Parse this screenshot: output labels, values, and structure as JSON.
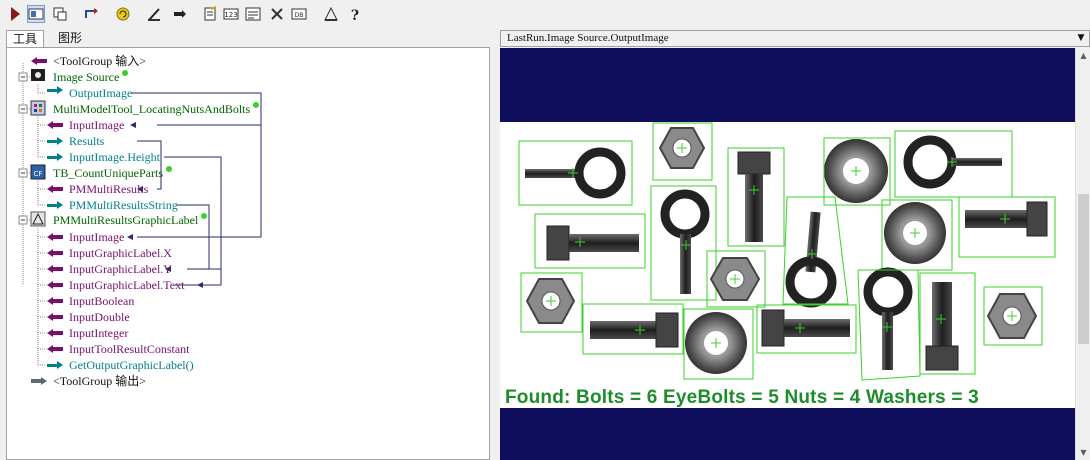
{
  "tabs": {
    "tools": "工具",
    "graphics": "图形"
  },
  "tree": {
    "group_input": "<ToolGroup 输入>",
    "image_source": "Image Source",
    "output_image": "OutputImage",
    "multi_model": "MultiModelTool_LocatingNutsAndBolts",
    "mm_input_image": "InputImage",
    "mm_results": "Results",
    "mm_input_height": "InputImage.Height",
    "tb_count": "TB_CountUniqueParts",
    "tb_pm_results": "PMMultiResults",
    "tb_pm_results_string": "PMMultiResultsString",
    "graphic_label": "PMMultiResultsGraphicLabel",
    "gl_input_image": "InputImage",
    "gl_x": "InputGraphicLabel.X",
    "gl_y": "InputGraphicLabel.Y",
    "gl_text": "InputGraphicLabel.Text",
    "gl_boolean": "InputBoolean",
    "gl_double": "InputDouble",
    "gl_integer": "InputInteger",
    "gl_result_constant": "InputToolResultConstant",
    "gl_get_output": "GetOutputGraphicLabel()",
    "group_output": "<ToolGroup 输出>"
  },
  "viewer": {
    "title": "LastRun.Image Source.OutputImage",
    "found_text": "Found: Bolts = 6  EyeBolts = 5  Nuts = 4  Washers = 3"
  },
  "colors": {
    "dark_green": "#006400",
    "teal": "#00808a",
    "purple": "#7a0f6f",
    "navy": "#0e0e5c",
    "box_green": "#39d12a",
    "found_green": "#1e8c2a"
  }
}
